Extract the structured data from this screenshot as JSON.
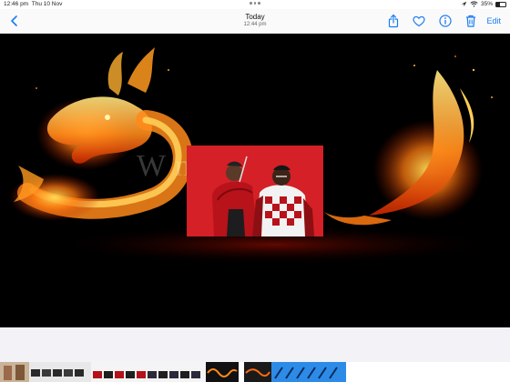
{
  "status_bar": {
    "time": "12:46 pm",
    "date": "Thu 10 Nov",
    "battery": "35%",
    "battery_level": 0.35
  },
  "nav": {
    "title": "Today",
    "subtitle": "12:44 pm",
    "edit_label": "Edit"
  },
  "photo": {
    "watermark": "W   nts"
  },
  "colors": {
    "accent": "#1a7cf2",
    "photo_bg": "#000000",
    "inset_bg": "#d42026"
  },
  "icons": [
    "chevron-left-icon",
    "share-icon",
    "heart-icon",
    "info-icon",
    "trash-icon",
    "wifi-icon",
    "battery-icon"
  ]
}
